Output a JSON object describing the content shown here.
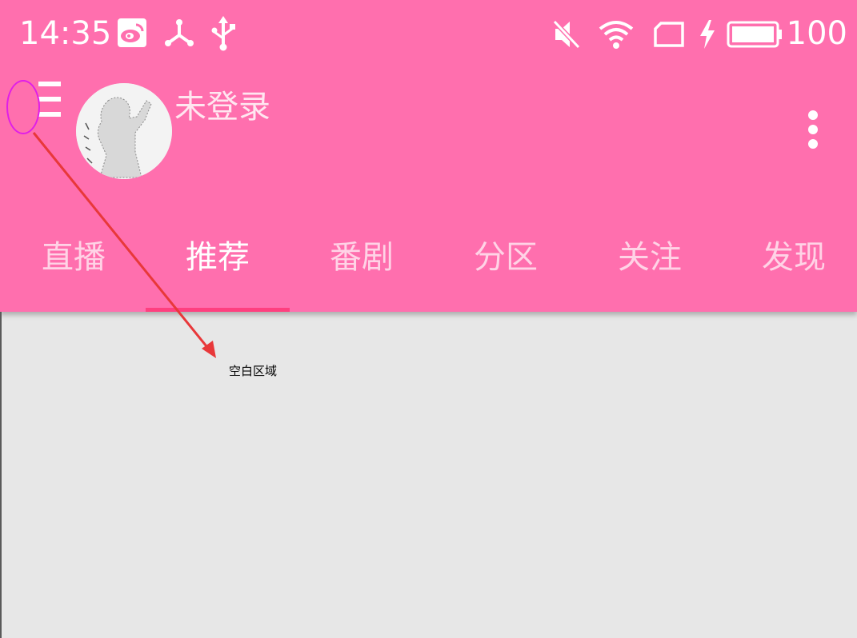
{
  "colors": {
    "appbar": "#ff6fae",
    "tab_indicator": "#ff3f7f",
    "content_bg": "#e7e7e7",
    "annotation_ellipse": "#e01ee8",
    "annotation_arrow": "#e8383a"
  },
  "status_bar": {
    "time": "14:35",
    "icons": [
      "weibo-icon",
      "share-network-icon",
      "usb-icon",
      "mute-icon",
      "wifi-icon",
      "sim-card-icon",
      "charging-icon",
      "battery-icon"
    ],
    "battery_level": "100"
  },
  "toolbar": {
    "menu_icon": "hamburger-icon",
    "user_name": "未登录",
    "more_icon": "more-vertical-icon"
  },
  "tabs": [
    {
      "label": "直播",
      "active": false
    },
    {
      "label": "推荐",
      "active": true
    },
    {
      "label": "番剧",
      "active": false
    },
    {
      "label": "分区",
      "active": false
    },
    {
      "label": "关注",
      "active": false
    },
    {
      "label": "发现",
      "active": false
    }
  ],
  "annotation": {
    "label": "空白区域"
  }
}
